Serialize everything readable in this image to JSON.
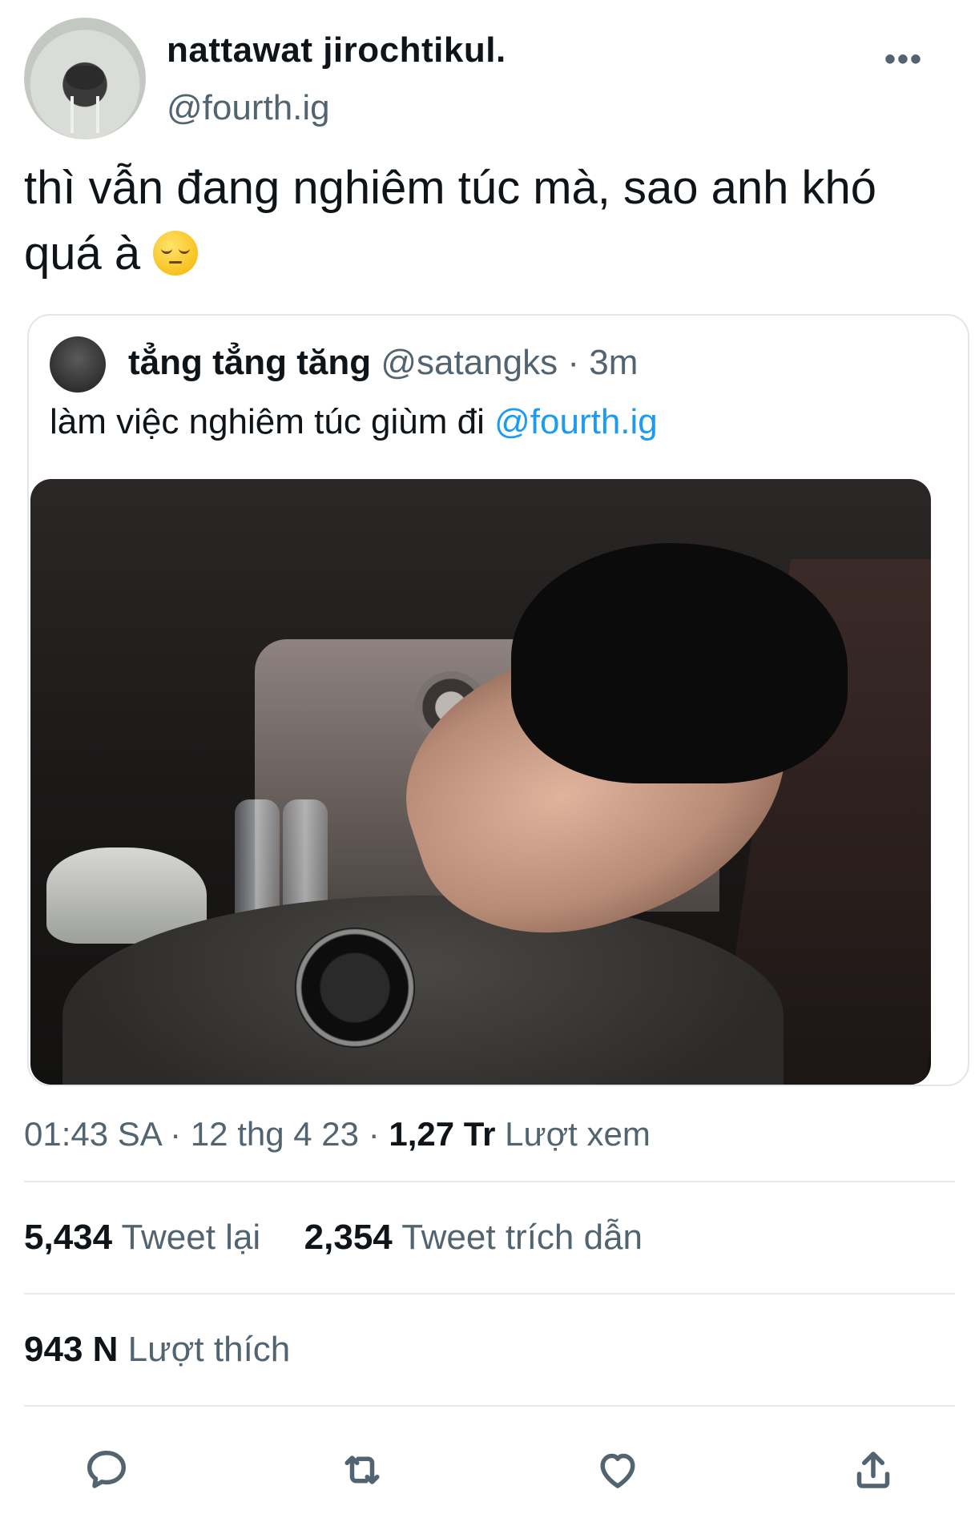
{
  "tweet": {
    "display_name": "nattawat jirochtikul.",
    "handle": "@fourth.ig",
    "more_label": "•••",
    "text": "thì vẫn đang nghiêm túc mà, sao anh khó quá à",
    "emoji": "pensive-face"
  },
  "quote": {
    "display_name": "tẳng tẳng tăng",
    "handle": "@satangks",
    "separator": "·",
    "time": "3m",
    "text": "làm việc nghiêm túc giùm đi",
    "mention": "@fourth.ig"
  },
  "meta": {
    "time": "01:43 SA",
    "date": "12 thg 4 23",
    "separator": "·",
    "views_count": "1,27 Tr",
    "views_label": "Lượt xem"
  },
  "stats": {
    "retweets_count": "5,434",
    "retweets_label": "Tweet lại",
    "quotes_count": "2,354",
    "quotes_label": "Tweet trích dẫn",
    "likes_count": "943 N",
    "likes_label": "Lượt thích"
  },
  "actions": {
    "reply_icon": "reply-icon",
    "retweet_icon": "retweet-icon",
    "like_icon": "heart-icon",
    "share_icon": "share-icon"
  },
  "colors": {
    "text": "#0f1419",
    "secondary": "#536471",
    "link": "#1d9bf0",
    "divider": "#e7eaec"
  }
}
